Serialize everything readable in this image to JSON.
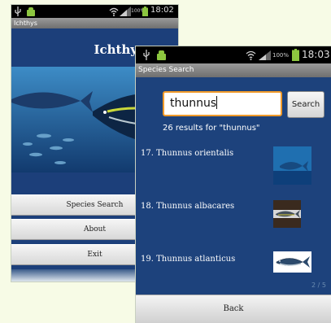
{
  "background_phone": {
    "status_bar": {
      "time": "18:02",
      "battery": "100%"
    },
    "title_bar": "Ichthys",
    "app_title": "Ichthys",
    "menu": [
      {
        "label": "Species Search"
      },
      {
        "label": "About"
      },
      {
        "label": "Exit"
      }
    ]
  },
  "foreground_phone": {
    "status_bar": {
      "time": "18:03",
      "battery": "100%"
    },
    "title_bar": "Species Search",
    "search": {
      "query": "thunnus",
      "button_label": "Search"
    },
    "results_count": "26 results for \"thunnus\"",
    "results": [
      {
        "label": "17. Thunnus orientalis"
      },
      {
        "label": "18. Thunnus albacares"
      },
      {
        "label": "19. Thunnus atlanticus"
      }
    ],
    "page_indicator": "2 / 5",
    "back_label": "Back"
  },
  "colors": {
    "app_background": "#1d427c",
    "search_focus_border": "#f09a2a",
    "status_bar": "#000000"
  }
}
